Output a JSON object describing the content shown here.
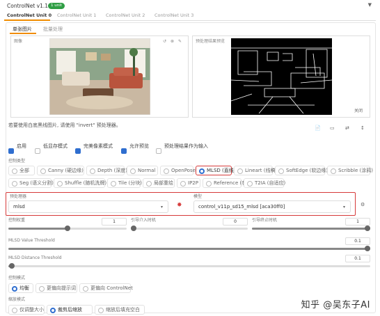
{
  "header": {
    "title": "ControlNet v1.1.224",
    "badge": "1 unit"
  },
  "tabs": [
    "ControlNet Unit 0",
    "ControlNet Unit 1",
    "ControlNet Unit 2",
    "ControlNet Unit 3"
  ],
  "image_tabs": [
    "单张图片",
    "批量处理"
  ],
  "left_image": {
    "label": "图像",
    "tools": [
      "↺",
      "⊗",
      "✎"
    ]
  },
  "right_image": {
    "label": "预处理结果预览",
    "footer": "关闭"
  },
  "hint": "若要使用白底黑线图片, 请使用 \"invert\" 预处理器。",
  "right_icons": [
    "📄",
    "▭",
    "⇄",
    "↕"
  ],
  "options": [
    {
      "label": "启用",
      "checked": true
    },
    {
      "label": "低显存模式",
      "checked": false
    },
    {
      "label": "完美像素模式",
      "checked": true
    },
    {
      "label": "允许预览",
      "checked": true
    },
    {
      "label": "预处理结果作为输入",
      "checked": false
    }
  ],
  "control_type": {
    "label": "控制类型",
    "row1": [
      "全部",
      "Canny (硬边缘)",
      "Depth (深度)",
      "Normal",
      "OpenPose (姿态)",
      "MLSD (直线)",
      "Lineart (线稿)",
      "SoftEdge (软边缘)",
      "Scribble (涂鸦)"
    ],
    "row2": [
      "Seg (语义分割)",
      "Shuffle (随机洗牌)",
      "Tile (分块)",
      "局部重绘",
      "IP2P",
      "Reference (参考)",
      "T2IA (自适应)"
    ],
    "selected": "MLSD (直线)"
  },
  "preprocessor": {
    "label": "预处理器",
    "value": "mlsd"
  },
  "model": {
    "label": "模型",
    "value": "control_v11p_sd15_mlsd [aca30ff0]"
  },
  "weight": {
    "label": "控制权重",
    "value": "1",
    "level": 0.5
  },
  "start_step": {
    "label": "引导介入时机",
    "value": "0",
    "level": 0.0
  },
  "end_step": {
    "label": "引导终止时机",
    "value": "1",
    "level": 1.0
  },
  "mlsd_value": {
    "label": "MLSD Value Threshold",
    "value": "0.1",
    "level": 1.0
  },
  "mlsd_distance": {
    "label": "MLSD Distance Threshold",
    "value": "0.1",
    "level": 0.01
  },
  "control_mode": {
    "label": "控制模式",
    "items": [
      "均衡",
      "更偏向提示词",
      "更偏向 ControlNet"
    ],
    "selected": 0
  },
  "resize_mode": {
    "label": "缩放模式",
    "items": [
      "仅调整大小",
      "裁剪后缩放",
      "缩放后填充空白"
    ],
    "selected": 1
  },
  "watermark": "知乎 @吴东子AI",
  "colors": {
    "accent": "#f08c00",
    "check": "#2f6ecf",
    "highlight": "#d63a3a",
    "badge": "#2f9e44"
  }
}
